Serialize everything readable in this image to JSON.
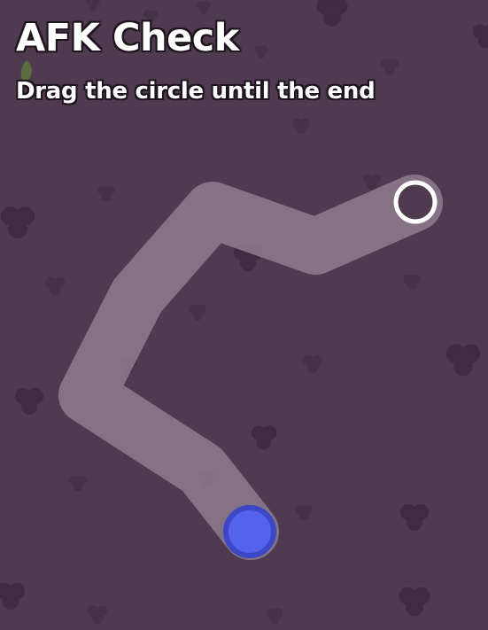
{
  "header": {
    "title": "AFK Check",
    "subtitle": "Drag the circle until the end"
  },
  "colors": {
    "background": "#4f3a4f",
    "decoration": "#3f2c40",
    "path": "#8d7c8e",
    "end_hole": "#4f3a4f",
    "handle_fill": "#5562ee",
    "handle_border": "#3d46c4",
    "leaf": "#5c7a3c"
  },
  "icons": {
    "handle": "drag-circle-icon",
    "end": "end-target-icon",
    "leaf": "leaf-icon"
  }
}
